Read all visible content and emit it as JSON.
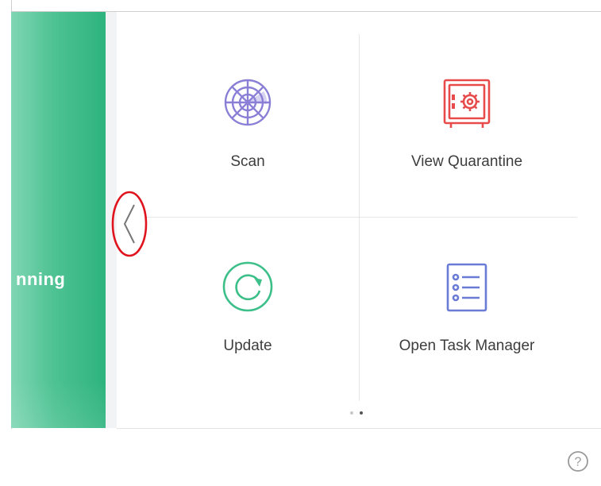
{
  "sidebar": {
    "status_text": "nning"
  },
  "tiles": [
    {
      "label": "Scan",
      "icon": "scan-radar-icon"
    },
    {
      "label": "View Quarantine",
      "icon": "quarantine-safe-icon"
    },
    {
      "label": "Update",
      "icon": "update-refresh-icon"
    },
    {
      "label": "Open Task Manager",
      "icon": "task-list-icon"
    }
  ],
  "navigation": {
    "back_icon": "chevron-left-icon",
    "pager_pages": 2,
    "pager_current": 2
  },
  "help": {
    "icon": "help-circle-icon",
    "glyph": "?"
  },
  "colors": {
    "green_panel": "#2db37d",
    "scan_icon": "#8a7fd6",
    "quarantine_icon": "#e84b4b",
    "update_icon": "#3dbf8a",
    "task_icon": "#6a7bd6",
    "annotation": "#e0141e",
    "label_text": "#3d3d3d"
  }
}
